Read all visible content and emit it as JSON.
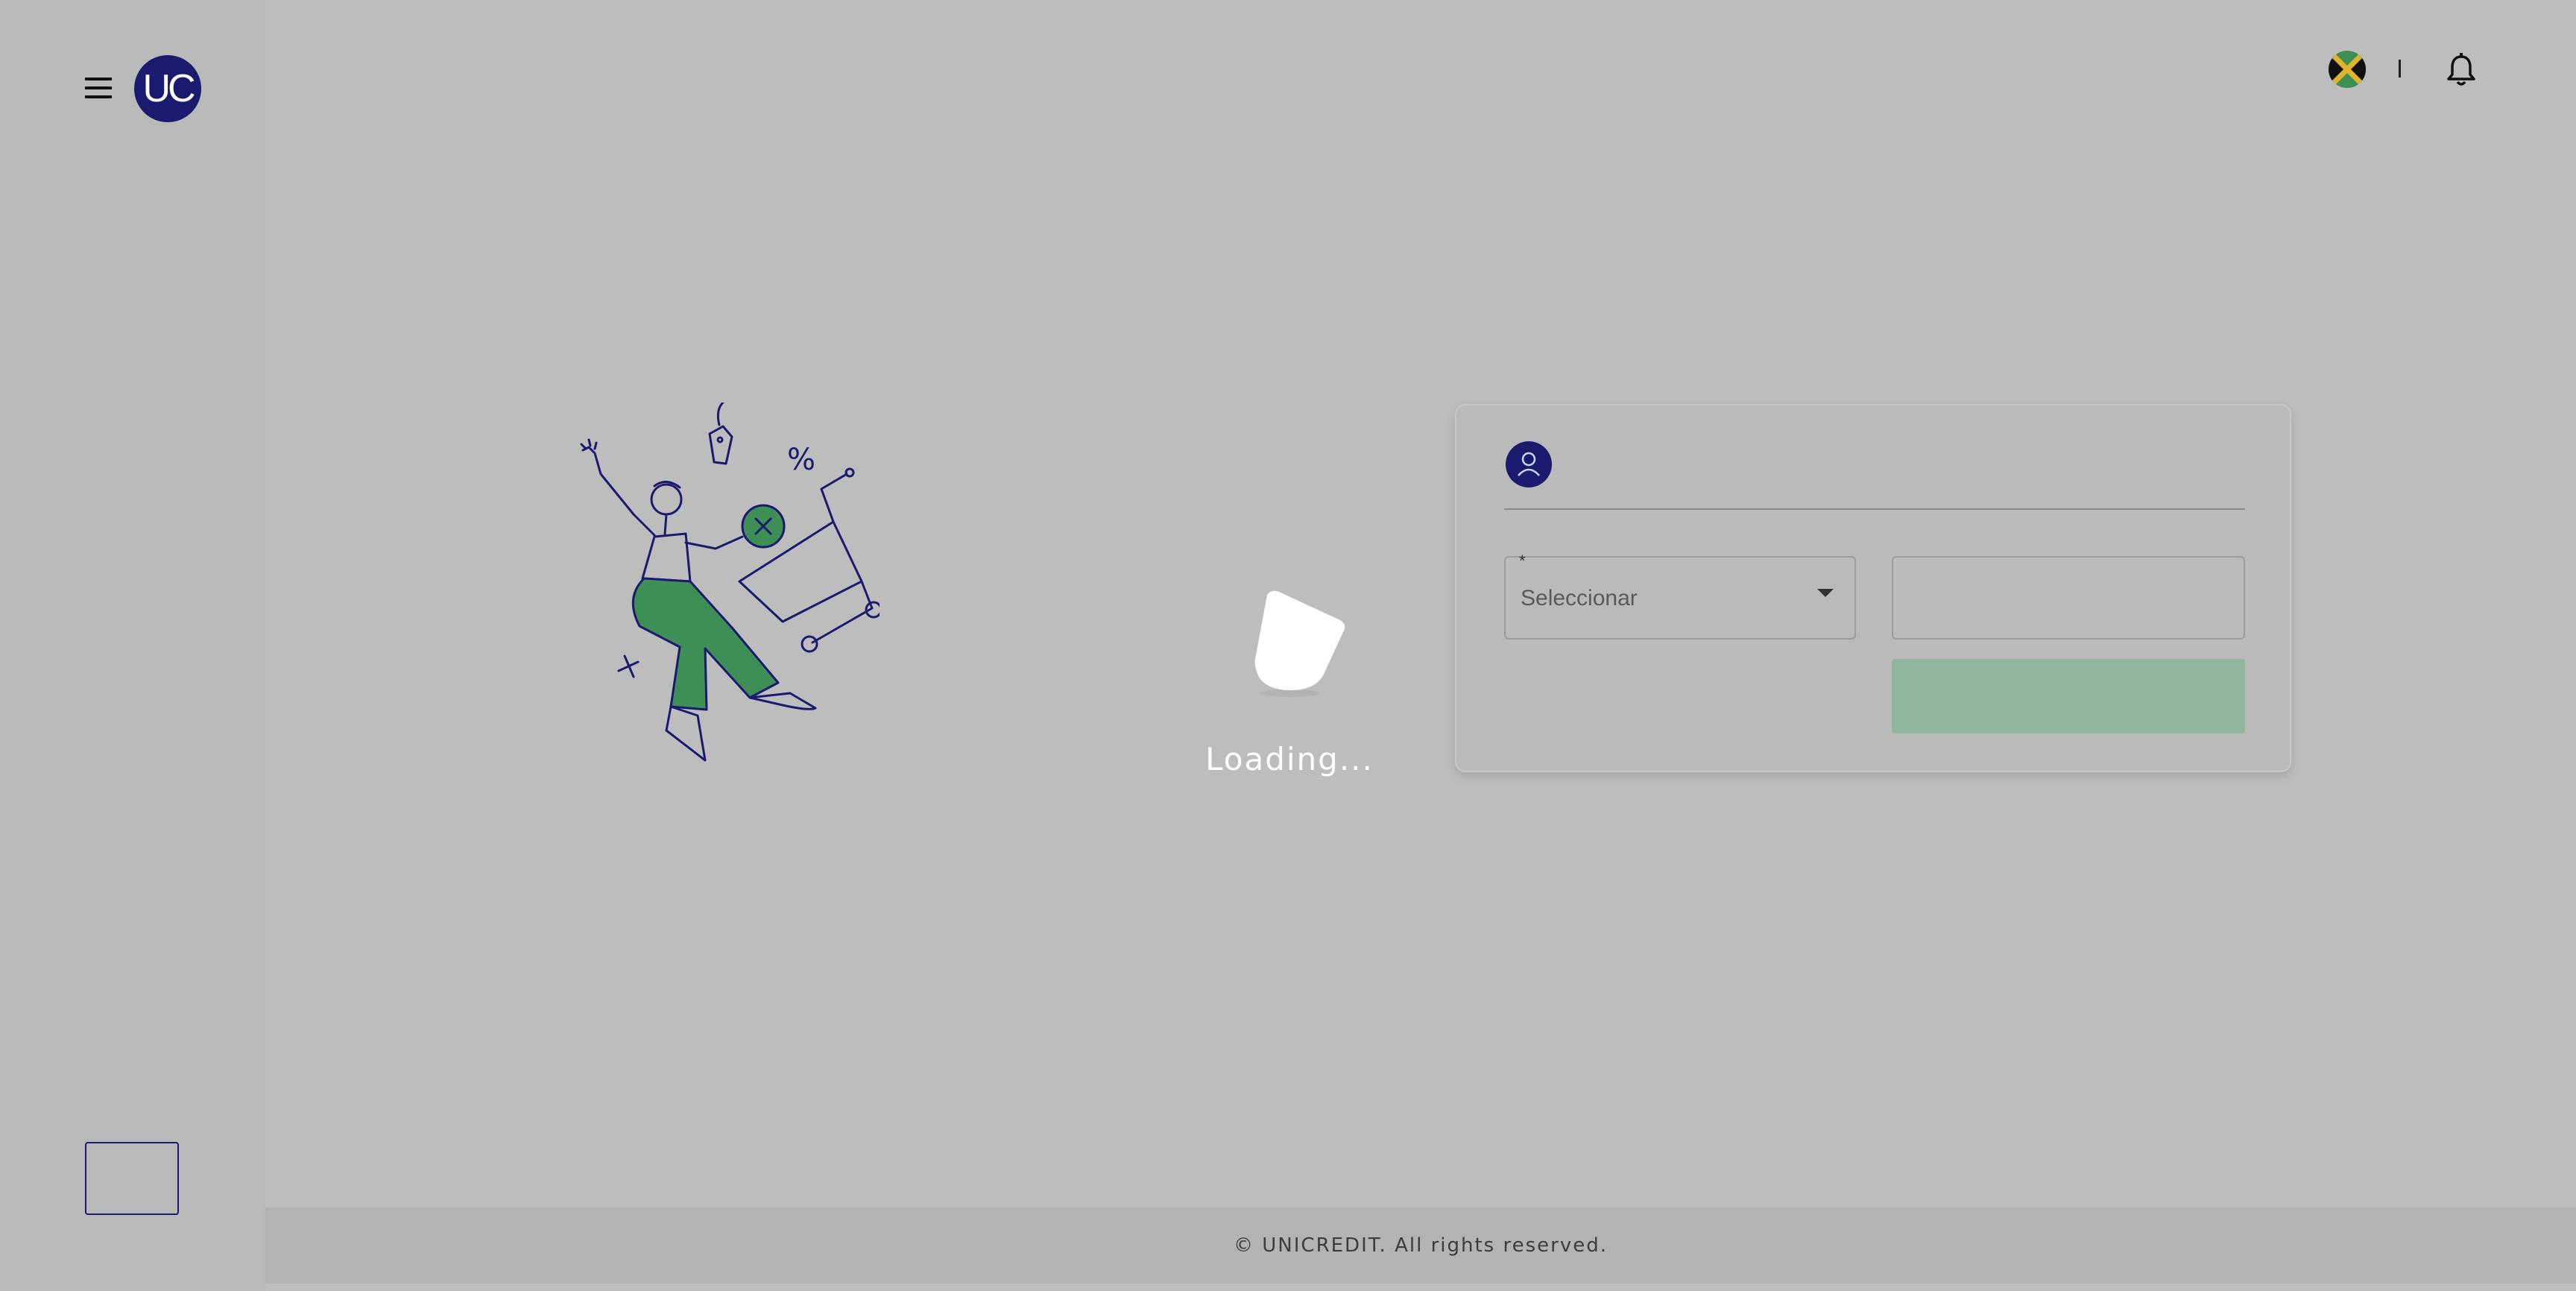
{
  "app": {
    "logo_text": "UC"
  },
  "header": {
    "flag_icon": "jamaica-flag-icon",
    "bell_icon": "bell-icon"
  },
  "loader": {
    "text": "Loading..."
  },
  "form": {
    "required_marker": "*",
    "select_value": "Seleccionar",
    "input_value": "",
    "submit_label": ""
  },
  "footer": {
    "copyright": "© UNICREDIT. All rights reserved."
  },
  "colors": {
    "brand_navy": "#1a1a6e",
    "accent_green": "#3e8f55",
    "button_disabled": "#8fb59d",
    "overlay_gray": "#bdbdbd"
  }
}
